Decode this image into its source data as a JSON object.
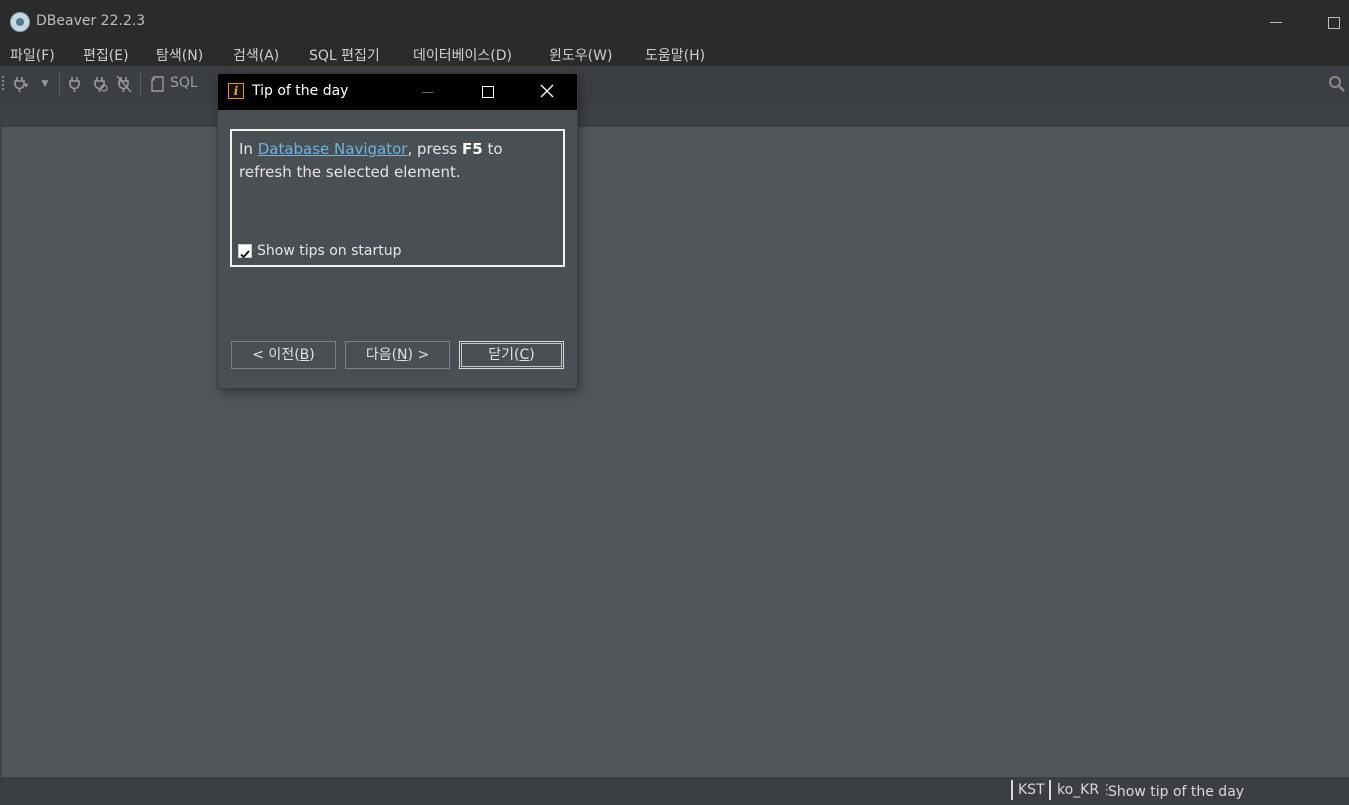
{
  "window": {
    "title": "DBeaver 22.2.3"
  },
  "menu": {
    "items": [
      "파일(F)",
      "편집(E)",
      "탐색(N)",
      "검색(A)",
      "SQL 편집기",
      "데이터베이스(D)",
      "윈도우(W)",
      "도움말(H)"
    ]
  },
  "toolbar": {
    "sql_label": "SQL"
  },
  "dialog": {
    "title": "Tip of the day",
    "tip_prefix": "In ",
    "tip_link": "Database Navigator",
    "tip_middle": ", press ",
    "tip_key": "F5",
    "tip_suffix": " to refresh the selected element.",
    "show_tips_label": "Show tips on startup",
    "show_tips_checked": true,
    "prev_button": {
      "pre": "< 이전(",
      "mnemonic": "B",
      "post": ")"
    },
    "next_button": {
      "pre": "다음(",
      "mnemonic": "N",
      "post": ") >"
    },
    "close_button": {
      "pre": "닫기(",
      "mnemonic": "C",
      "post": ")"
    }
  },
  "status": {
    "timezone": "KST",
    "locale": "ko_KR",
    "message": "Show tip of the day"
  },
  "colors": {
    "background": "#50565a",
    "titlebar": "#2b2b2b",
    "link": "#6fb3e0",
    "dialog_icon": "#e8912b"
  }
}
